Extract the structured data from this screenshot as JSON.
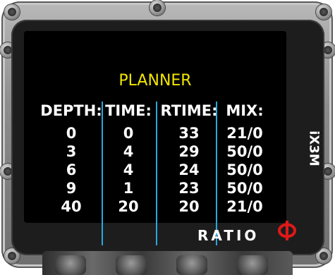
{
  "planner": {
    "title": "PLANNER",
    "headers": {
      "depth": "DEPTH:",
      "time": "TIME:",
      "rtime": "RTIME:",
      "mix": "MIX:"
    },
    "rows": [
      {
        "depth": "0",
        "time": "0",
        "rtime": "33",
        "mix": "21/0"
      },
      {
        "depth": "3",
        "time": "4",
        "rtime": "29",
        "mix": "50/0"
      },
      {
        "depth": "6",
        "time": "4",
        "rtime": "24",
        "mix": "50/0"
      },
      {
        "depth": "9",
        "time": "1",
        "rtime": "23",
        "mix": "50/0"
      },
      {
        "depth": "40",
        "time": "20",
        "rtime": "20",
        "mix": "21/0"
      }
    ]
  },
  "device": {
    "model": "iX3M",
    "brand": "RATIO"
  },
  "colors": {
    "title": "#f2e600",
    "divider": "#2aa7e0",
    "logo": "#e01818"
  }
}
